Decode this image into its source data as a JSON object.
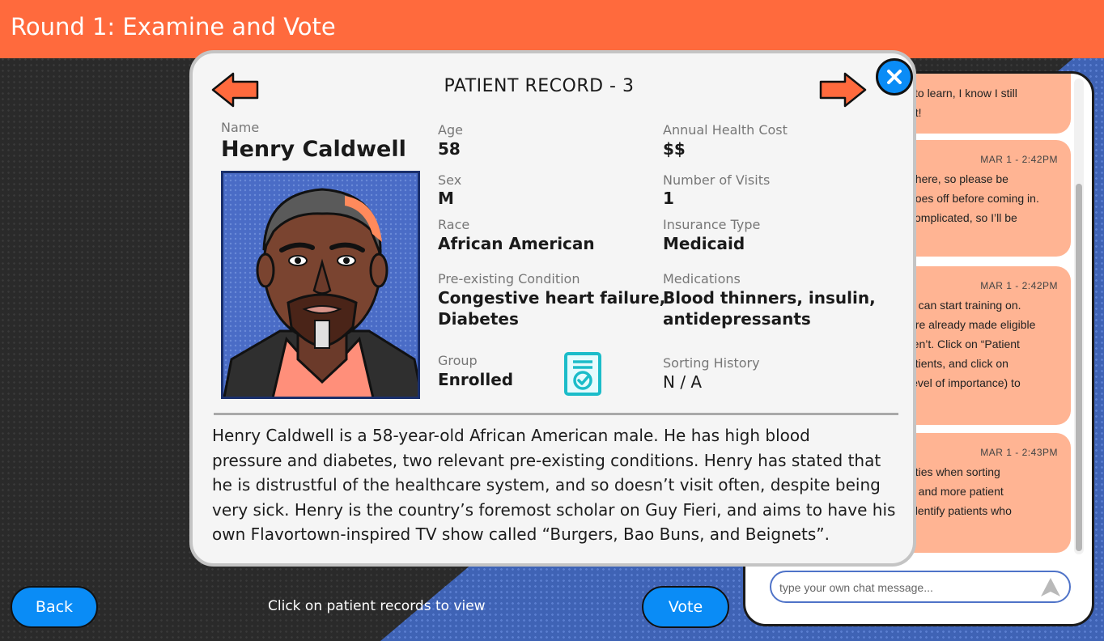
{
  "header": {
    "title": "Round 1: Examine and Vote"
  },
  "modal": {
    "title": "PATIENT RECORD - 3",
    "fields": {
      "name_label": "Name",
      "name": "Henry Caldwell",
      "age_label": "Age",
      "age": "58",
      "sex_label": "Sex",
      "sex": "M",
      "race_label": "Race",
      "race": "African American",
      "condition_label": "Pre-existing Condition",
      "condition_1": "Congestive heart failure,",
      "condition_2": "Diabetes",
      "group_label": "Group",
      "group": "Enrolled",
      "cost_label": "Annual Health Cost",
      "cost": "$$",
      "visits_label": "Number of Visits",
      "visits": "1",
      "insurance_label": "Insurance Type",
      "insurance": "Medicaid",
      "meds_label": "Medications",
      "meds_1": "Blood thinners, insulin,",
      "meds_2": "antidepressants",
      "sorting_label": "Sorting History",
      "sorting": "N / A"
    },
    "description_lines": [
      "Henry Caldwell is a 58-year-old African American male. He has high blood",
      "pressure and diabetes, two relevant pre-existing conditions. Henry has stated that",
      "he is distrustful of the healthcare system, and so doesn’t visit often, despite being",
      "very sick. Henry is the country’s foremost scholar on Guy Fieri, and aims to have his",
      "own Flavortown-inspired TV show called “Burgers, Bao Buns, and Beignets”."
    ]
  },
  "chat": {
    "messages": [
      {
        "time": "",
        "lines": [
          "l to learn, I know I still",
          "nt!"
        ]
      },
      {
        "time": "MAR 1 - 2:42PM",
        "lines": [
          "t here, so please be",
          "hoes off before coming in.",
          "complicated, so I’ll be"
        ]
      },
      {
        "time": "MAR 1 - 2:42PM",
        "lines": [
          "e can start training on.",
          "ere already made eligible",
          "ren’t. Click on “Patient",
          "atients, and click on",
          "level of importance) to"
        ]
      },
      {
        "time": "MAR 1 - 2:43PM",
        "lines": [
          "rities when sorting",
          "e and more patient",
          " identify patients who",
          "!"
        ]
      }
    ],
    "input_placeholder": "type your own chat message..."
  },
  "footer": {
    "back_label": "Back",
    "vote_label": "Vote",
    "hint": "Click on patient records to view"
  },
  "colors": {
    "header": "#ff6a3d",
    "button": "#0a8cf6",
    "bubble": "#ffb493",
    "arrow": "#ff6a3d",
    "icon_teal": "#1bbcc9"
  }
}
